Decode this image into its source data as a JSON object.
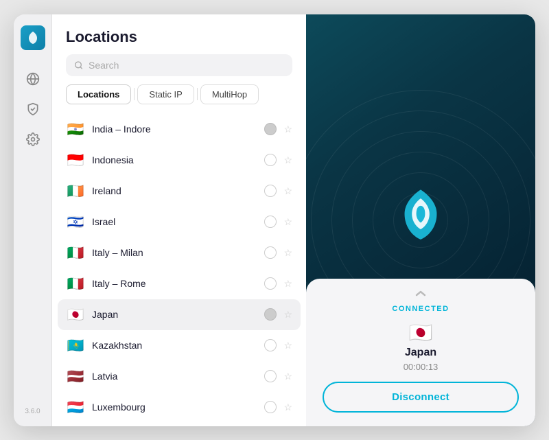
{
  "app": {
    "version": "3.6.0"
  },
  "sidebar": {
    "items": [
      {
        "name": "globe-icon",
        "label": "Locations"
      },
      {
        "name": "shield-icon",
        "label": "Protection"
      },
      {
        "name": "settings-icon",
        "label": "Settings"
      }
    ]
  },
  "locations_panel": {
    "title": "Locations",
    "search": {
      "placeholder": "Search"
    },
    "tabs": [
      {
        "id": "locations",
        "label": "Locations",
        "active": true
      },
      {
        "id": "static-ip",
        "label": "Static IP",
        "active": false
      },
      {
        "id": "multihop",
        "label": "MultiHop",
        "active": false
      }
    ],
    "items": [
      {
        "flag": "🇮🇳",
        "name": "India – Indore",
        "connected": true,
        "starred": false
      },
      {
        "flag": "🇮🇩",
        "name": "Indonesia",
        "connected": false,
        "starred": false
      },
      {
        "flag": "🇮🇪",
        "name": "Ireland",
        "connected": false,
        "starred": false
      },
      {
        "flag": "🇮🇱",
        "name": "Israel",
        "connected": false,
        "starred": false
      },
      {
        "flag": "🇮🇹",
        "name": "Italy – Milan",
        "connected": false,
        "starred": false
      },
      {
        "flag": "🇮🇹",
        "name": "Italy – Rome",
        "connected": false,
        "starred": false
      },
      {
        "flag": "🇯🇵",
        "name": "Japan",
        "connected": true,
        "starred": false,
        "active": true
      },
      {
        "flag": "🇰🇿",
        "name": "Kazakhstan",
        "connected": false,
        "starred": false
      },
      {
        "flag": "🇱🇻",
        "name": "Latvia",
        "connected": false,
        "starred": false
      },
      {
        "flag": "🇱🇺",
        "name": "Luxembourg",
        "connected": false,
        "starred": false
      }
    ]
  },
  "connection": {
    "status_label": "CONNECTED",
    "country": "Japan",
    "flag": "🇯🇵",
    "timer": "00:00:13",
    "disconnect_label": "Disconnect"
  }
}
